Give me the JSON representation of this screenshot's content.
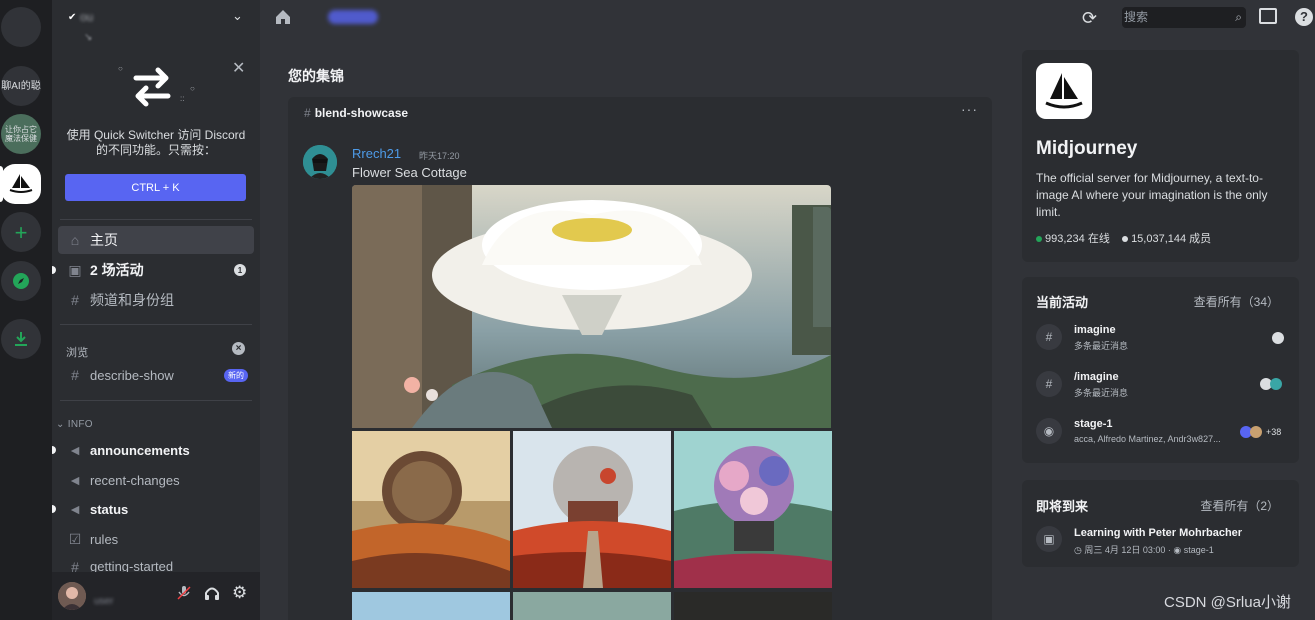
{
  "servers": [
    {
      "label": ""
    },
    {
      "label": "聊AI的聪"
    },
    {
      "label": "让你占它 魔法保健"
    },
    {
      "label": ""
    },
    {
      "label": "+"
    },
    {
      "label": "explore"
    },
    {
      "label": "download"
    }
  ],
  "sidebar": {
    "server_name": "ou",
    "quick_switcher": {
      "description": "使用 Quick Switcher 访问 Discord 的不同功能。只需按：",
      "shortcut": "CTRL + K"
    },
    "nav": [
      {
        "label": "主页",
        "icon": "home-icon"
      },
      {
        "label": "2 场活动",
        "icon": "calendar-icon",
        "count": "1"
      },
      {
        "label": "频道和身份组",
        "icon": "channels-roles-icon"
      }
    ],
    "browse_label": "浏览",
    "browse_channel": {
      "label": "describe-show",
      "badge": "新的"
    },
    "category": "INFO",
    "channels": [
      {
        "label": "announcements",
        "icon": "megaphone-icon",
        "unread": true
      },
      {
        "label": "recent-changes",
        "icon": "megaphone-icon",
        "unread": false
      },
      {
        "label": "status",
        "icon": "megaphone-icon",
        "unread": true
      },
      {
        "label": "rules",
        "icon": "checkbox-icon",
        "unread": false
      },
      {
        "label": "getting-started",
        "icon": "hash-icon",
        "unread": false
      }
    ]
  },
  "topbar": {
    "search_placeholder": "搜索"
  },
  "featured": {
    "title": "您的集锦",
    "channel": "blend-showcase",
    "message": {
      "author": "Rrech21",
      "time": "昨天17:20",
      "text": "Flower Sea Cottage"
    }
  },
  "server_card": {
    "name": "Midjourney",
    "description": "The official server for Midjourney, a text-to-image AI where your imagination is the only limit.",
    "online": "993,234 在线",
    "members": "15,037,144 成员",
    "online_color": "#23a559"
  },
  "activities": {
    "title": "当前活动",
    "link": "查看所有（34）",
    "items": [
      {
        "name": "imagine",
        "sub": "多条最近消息",
        "icon": "thread-icon"
      },
      {
        "name": "/imagine",
        "sub": "多条最近消息",
        "icon": "thread-icon"
      },
      {
        "name": "stage-1",
        "sub": "acca, Alfredo Martinez, Andr3w827...",
        "icon": "stage-icon",
        "count": "+38"
      }
    ]
  },
  "upcoming": {
    "title": "即将到来",
    "link": "查看所有（2）",
    "event_name": "Learning with Peter Mohrbacher",
    "event_time": "周三 4月 12日 03:00",
    "event_place": "stage-1"
  },
  "watermark": "CSDN @Srlua小谢",
  "colors": {
    "accent": "#5865f2",
    "link": "#4e9be8",
    "bg": "#313338"
  }
}
